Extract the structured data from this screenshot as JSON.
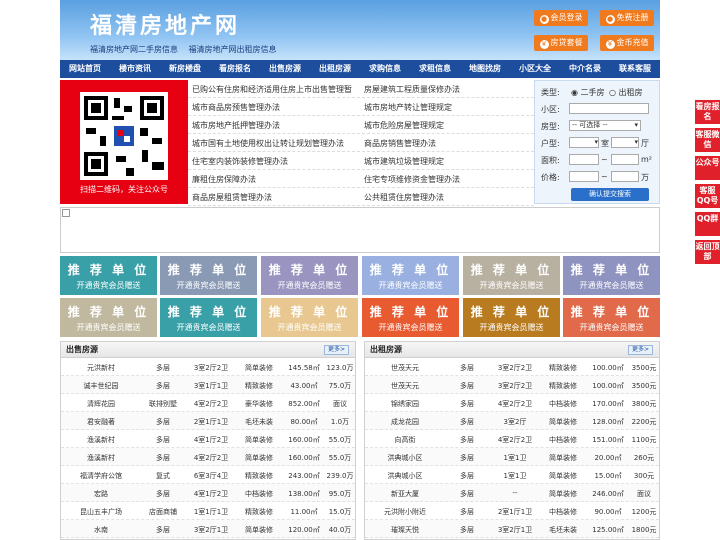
{
  "header": {
    "title": "福清房地产网",
    "sub_links": [
      "福清房地产网二手房信息",
      "福清房地产网出租房信息"
    ],
    "buttons": [
      "会员登录",
      "免费注册",
      "房贷套餐",
      "金币充值"
    ]
  },
  "nav": [
    "网站首页",
    "楼市资讯",
    "新房楼盘",
    "看房报名",
    "出售房源",
    "出租房源",
    "求购信息",
    "求租信息",
    "地图找房",
    "小区大全",
    "中介名录",
    "联系客服"
  ],
  "qr": {
    "caption": "扫描二维码，关注公众号"
  },
  "links_left": [
    "已购公有住房和经济适用住房上市出售管理暂",
    "城市商品房预售管理办法",
    "城市房地产抵押管理办法",
    "城市国有土地使用权出让转让规划管理办法",
    "住宅室内装饰装修管理办法",
    "廉租住房保障办法",
    "商品房屋租赁管理办法"
  ],
  "links_right": [
    "房屋建筑工程质量保修办法",
    "城市房地产转让管理规定",
    "城市危险房屋管理规定",
    "商品房销售管理办法",
    "城市建筑垃圾管理规定",
    "住宅专项维修资金管理办法",
    "公共租赁住房管理办法"
  ],
  "search": {
    "type_label": "类型:",
    "type_opt1": "二手房",
    "type_opt2": "出租房",
    "community_label": "小区:",
    "house_type_label": "房型:",
    "house_type_value": "-- 可选择 --",
    "layout_label": "户型:",
    "room_unit": "室",
    "hall_unit": "厅",
    "area_label": "面积:",
    "area_to": "~",
    "area_unit": "m²",
    "price_label": "价格:",
    "price_to": "~",
    "price_unit": "万",
    "submit": "确认提交搜索"
  },
  "ads": {
    "title": "推 荐 单 位",
    "subtitle": "开通贵宾会员赠送",
    "row1_colors": [
      "#3aa0a8",
      "#8a9ab5",
      "#9a94c0",
      "#9ab0e0",
      "#b8b0a0",
      "#8f93c0"
    ],
    "row2_colors": [
      "#c0b9a0",
      "#3aa0a8",
      "#e8c890",
      "#e85a30",
      "#b87b20",
      "#e06a4a"
    ]
  },
  "sale": {
    "title": "出售房源",
    "more": "更多>",
    "rows": [
      [
        "元洪新村",
        "多层",
        "3室2厅2卫",
        "简单装修",
        "145.58㎡",
        "123.0万"
      ],
      [
        "诚丰世纪园",
        "多层",
        "3室1厅1卫",
        "精致装修",
        "43.00㎡",
        "75.0万"
      ],
      [
        "清辉花园",
        "联排别墅",
        "4室2厅2卫",
        "豪华装修",
        "852.00㎡",
        "面议"
      ],
      [
        "君安融著",
        "多层",
        "2室1厅1卫",
        "毛坯未装",
        "80.00㎡",
        "1.0万"
      ],
      [
        "渔溪新村",
        "多层",
        "4室1厅2卫",
        "简单装修",
        "160.00㎡",
        "55.0万"
      ],
      [
        "渔溪新村",
        "多层",
        "4室2厅2卫",
        "简单装修",
        "160.00㎡",
        "55.0万"
      ],
      [
        "福清学府公馆",
        "复式",
        "6室3厅4卫",
        "精致装修",
        "243.00㎡",
        "239.0万"
      ],
      [
        "宏路",
        "多层",
        "4室1厅2卫",
        "中档装修",
        "138.00㎡",
        "95.0万"
      ],
      [
        "昆山五丰广场",
        "店面商铺",
        "1室1厅1卫",
        "精致装修",
        "11.00㎡",
        "15.0万"
      ],
      [
        "水南",
        "多层",
        "3室2厅1卫",
        "简单装修",
        "120.00㎡",
        "40.0万"
      ]
    ]
  },
  "rent": {
    "title": "出租房源",
    "more": "更多>",
    "rows": [
      [
        "世茂天元",
        "多层",
        "3室2厅2卫",
        "精致装修",
        "100.00㎡",
        "3500元"
      ],
      [
        "世茂天元",
        "多层",
        "3室2厅2卫",
        "精致装修",
        "100.00㎡",
        "3500元"
      ],
      [
        "锦绣家园",
        "多层",
        "4室2厅2卫",
        "中档装修",
        "170.00㎡",
        "3800元"
      ],
      [
        "成龙花园",
        "多层",
        "3室2厅",
        "简单装修",
        "128.00㎡",
        "2200元"
      ],
      [
        "向高街",
        "多层",
        "4室2厅2卫",
        "中档装修",
        "151.00㎡",
        "1100元"
      ],
      [
        "洪典城小区",
        "多层",
        "1室1卫",
        "简单装修",
        "20.00㎡",
        "260元"
      ],
      [
        "洪典城小区",
        "多层",
        "1室1卫",
        "简单装修",
        "15.00㎡",
        "300元"
      ],
      [
        "新亚大厦",
        "多层",
        "--",
        "简单装修",
        "246.00㎡",
        "面议"
      ],
      [
        "元洪附小附近",
        "多层",
        "2室1厅1卫",
        "中档装修",
        "90.00㎡",
        "1200元"
      ],
      [
        "璀璨天悦",
        "多层",
        "3室2厅1卫",
        "毛坯未装",
        "125.00㎡",
        "1800元"
      ]
    ]
  },
  "side": [
    "看房报名",
    "客服微信",
    "公众号",
    "客服QQ号",
    "QQ群",
    "返回顶部"
  ]
}
